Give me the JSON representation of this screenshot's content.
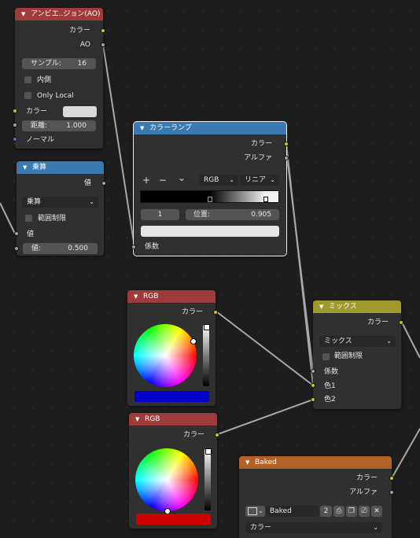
{
  "nodes": {
    "ao": {
      "title": "アンビエ..ジョン(AO)",
      "header_color": "#a03b3b",
      "out_color": "カラー",
      "out_ao": "AO",
      "samples_label": "サンプル:",
      "samples_value": "16",
      "inside_label": "内側",
      "only_local_label": "Only Local",
      "in_color_label": "カラー",
      "distance_label": "距離:",
      "distance_value": "1.000",
      "normal_label": "ノーマル"
    },
    "math": {
      "title": "乗算",
      "header_color": "#3b7ab0",
      "out_value": "値",
      "operation": "乗算",
      "clamp_label": "範囲制限",
      "in_value_label": "値",
      "value_label": "値:",
      "value_value": "0.500"
    },
    "ramp": {
      "title": "カラーランプ",
      "header_color": "#3b7ab0",
      "out_color": "カラー",
      "out_alpha": "アルファ",
      "add": "+",
      "remove": "−",
      "menu": "⌄",
      "mode": "RGB",
      "interpolation": "リニア",
      "stop_index": "1",
      "pos_label": "位置:",
      "pos_value": "0.905",
      "stop_positions": [
        0.5,
        0.905
      ],
      "in_fac": "係数"
    },
    "rgb1": {
      "title": "RGB",
      "header_color": "#a03b3b",
      "out_color": "カラー",
      "swatch_color": "#0000c8"
    },
    "rgb2": {
      "title": "RGB",
      "header_color": "#a03b3b",
      "out_color": "カラー",
      "swatch_color": "#cc0000"
    },
    "mix": {
      "title": "ミックス",
      "header_color": "#a09a2e",
      "out_color": "カラー",
      "blend": "ミックス",
      "clamp_label": "範囲制限",
      "in_fac": "係数",
      "in_color1": "色1",
      "in_color2": "色2"
    },
    "baked": {
      "title": "Baked",
      "header_color": "#b06228",
      "out_color": "カラー",
      "out_alpha": "アルファ",
      "image_name": "Baked",
      "users": "2",
      "colorspace": "カラー"
    }
  }
}
